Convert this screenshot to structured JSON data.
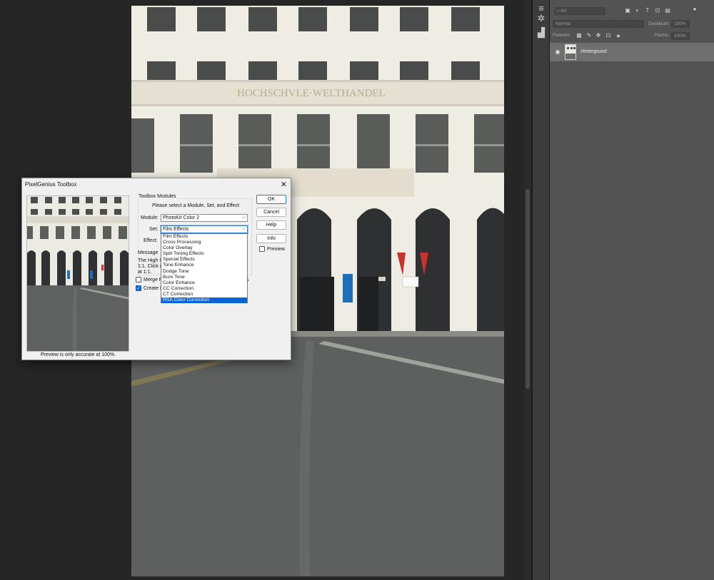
{
  "dialog": {
    "title": "PixelGenius Toolbox",
    "close_glyph": "✕",
    "preview_caption": "Preview is only accurate at 100%.",
    "modules_group_label": "Toolbox Modules",
    "instruction": "Please select a Module, Set, and Effect",
    "module_label": "Module:",
    "module_value": "PhotoKit Color 2",
    "set_label": "Set:",
    "set_value": "Film Effects",
    "effect_label": "Effect:",
    "effect_options": [
      "Film Effects",
      "Cross Processing",
      "Color Overlay",
      "Split Toning Effects",
      "Special Effects",
      "Tone Enhance",
      "Dodge Tone",
      "Burn Tone",
      "Color Enhance",
      "CC Correction",
      "CT Correction",
      "RSA Color Correction"
    ],
    "selected_effect": "RSA Color Correction",
    "message_label": "Message",
    "message_line1": "The High Q",
    "message_line2": "1:1. Click o",
    "message_line3": "at 1:1.",
    "merge_label": "Merge R",
    "merge_suffix": "s",
    "create_label": "Create L",
    "buttons": {
      "ok": "OK",
      "cancel": "Cancel",
      "help": "Help",
      "info": "Info"
    },
    "preview_checkbox_label": "Preview"
  },
  "layers_panel": {
    "search_placeholder": "Art",
    "blend_mode": "Normal",
    "opacity_label": "Deckkraft:",
    "opacity_value": "100%",
    "lock_label": "Fixieren:",
    "fill_label": "Fläche:",
    "fill_value": "100%",
    "layer_name": "Hintergrund"
  },
  "photo": {
    "facade_inscription": "HOCHSCHVLE·WELTHANDEL"
  },
  "colors": {
    "selection_blue": "#0a64d6",
    "focus_blue": "#2b78d4",
    "panel_gray": "#535353",
    "workspace_dark": "#262626"
  }
}
